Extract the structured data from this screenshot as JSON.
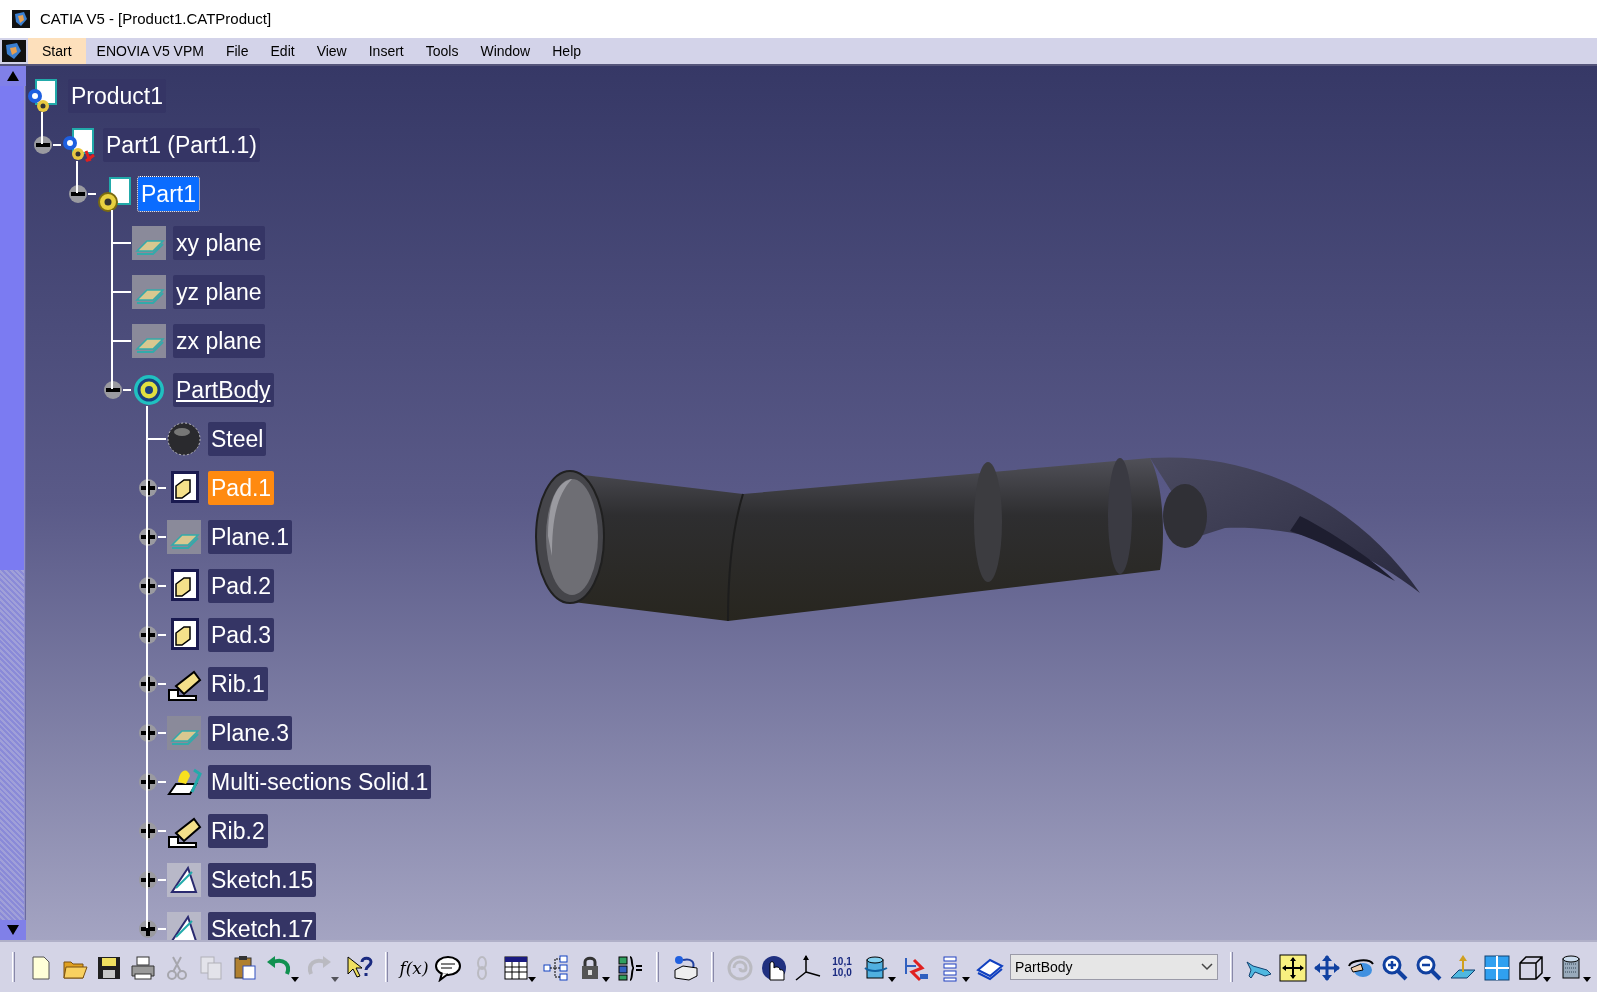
{
  "window": {
    "title": "CATIA V5 - [Product1.CATProduct]"
  },
  "menu": [
    {
      "label": "Start",
      "selected": true
    },
    {
      "label": "ENOVIA V5 VPM",
      "selected": false
    },
    {
      "label": "File",
      "selected": false
    },
    {
      "label": "Edit",
      "selected": false
    },
    {
      "label": "View",
      "selected": false
    },
    {
      "label": "Insert",
      "selected": false
    },
    {
      "label": "Tools",
      "selected": false
    },
    {
      "label": "Window",
      "selected": false
    },
    {
      "label": "Help",
      "selected": false
    }
  ],
  "tree": [
    {
      "label": "Product1",
      "kind": "product",
      "expandable": false,
      "selected": false,
      "preselected": false,
      "in_work": false,
      "children": [
        {
          "label": "Part1 (Part1.1)",
          "kind": "part-instance",
          "expandable": true,
          "expanded": true,
          "selected": false,
          "preselected": false,
          "in_work": false,
          "children": [
            {
              "label": "Part1",
              "kind": "part",
              "expandable": true,
              "expanded": true,
              "selected": true,
              "preselected": false,
              "in_work": false,
              "children": [
                {
                  "label": "xy plane",
                  "kind": "plane",
                  "expandable": false,
                  "selected": false,
                  "preselected": false,
                  "in_work": false
                },
                {
                  "label": "yz plane",
                  "kind": "plane",
                  "expandable": false,
                  "selected": false,
                  "preselected": false,
                  "in_work": false
                },
                {
                  "label": "zx plane",
                  "kind": "plane",
                  "expandable": false,
                  "selected": false,
                  "preselected": false,
                  "in_work": false
                },
                {
                  "label": "PartBody",
                  "kind": "body",
                  "expandable": true,
                  "expanded": true,
                  "selected": false,
                  "preselected": false,
                  "in_work": true,
                  "children": [
                    {
                      "label": "Steel",
                      "kind": "material",
                      "expandable": false,
                      "selected": false,
                      "preselected": false,
                      "in_work": false
                    },
                    {
                      "label": "Pad.1",
                      "kind": "pad",
                      "expandable": true,
                      "expanded": false,
                      "selected": false,
                      "preselected": true,
                      "in_work": false
                    },
                    {
                      "label": "Plane.1",
                      "kind": "plane",
                      "expandable": true,
                      "expanded": false,
                      "selected": false,
                      "preselected": false,
                      "in_work": false
                    },
                    {
                      "label": "Pad.2",
                      "kind": "pad",
                      "expandable": true,
                      "expanded": false,
                      "selected": false,
                      "preselected": false,
                      "in_work": false
                    },
                    {
                      "label": "Pad.3",
                      "kind": "pad",
                      "expandable": true,
                      "expanded": false,
                      "selected": false,
                      "preselected": false,
                      "in_work": false
                    },
                    {
                      "label": "Rib.1",
                      "kind": "rib",
                      "expandable": true,
                      "expanded": false,
                      "selected": false,
                      "preselected": false,
                      "in_work": false
                    },
                    {
                      "label": "Plane.3",
                      "kind": "plane",
                      "expandable": true,
                      "expanded": false,
                      "selected": false,
                      "preselected": false,
                      "in_work": false
                    },
                    {
                      "label": "Multi-sections Solid.1",
                      "kind": "loft",
                      "expandable": true,
                      "expanded": false,
                      "selected": false,
                      "preselected": false,
                      "in_work": false
                    },
                    {
                      "label": "Rib.2",
                      "kind": "rib",
                      "expandable": true,
                      "expanded": false,
                      "selected": false,
                      "preselected": false,
                      "in_work": false
                    },
                    {
                      "label": "Sketch.15",
                      "kind": "sketch",
                      "expandable": true,
                      "expanded": false,
                      "selected": false,
                      "preselected": false,
                      "in_work": false
                    },
                    {
                      "label": "Sketch.17",
                      "kind": "sketch",
                      "expandable": true,
                      "expanded": false,
                      "selected": false,
                      "preselected": false,
                      "in_work": false
                    }
                  ]
                }
              ]
            }
          ]
        }
      ]
    }
  ],
  "toolbar": [
    {
      "kind": "grip"
    },
    {
      "kind": "new",
      "disabled": false,
      "dropdown": false
    },
    {
      "kind": "open",
      "disabled": false,
      "dropdown": false
    },
    {
      "kind": "save",
      "disabled": false,
      "dropdown": false
    },
    {
      "kind": "print",
      "disabled": false,
      "dropdown": false
    },
    {
      "kind": "cut",
      "disabled": true,
      "dropdown": false
    },
    {
      "kind": "copy",
      "disabled": true,
      "dropdown": false
    },
    {
      "kind": "paste",
      "disabled": false,
      "dropdown": false
    },
    {
      "kind": "undo",
      "disabled": false,
      "dropdown": true
    },
    {
      "kind": "redo",
      "disabled": true,
      "dropdown": true
    },
    {
      "kind": "whats-this",
      "disabled": false,
      "dropdown": false
    },
    {
      "kind": "grip"
    },
    {
      "kind": "formula",
      "label": "f(x)",
      "disabled": false,
      "dropdown": false
    },
    {
      "kind": "comment",
      "disabled": false,
      "dropdown": false
    },
    {
      "kind": "link",
      "disabled": true,
      "dropdown": false
    },
    {
      "kind": "table",
      "disabled": false,
      "dropdown": true
    },
    {
      "kind": "graph",
      "disabled": false,
      "dropdown": false
    },
    {
      "kind": "lock",
      "disabled": false,
      "dropdown": true
    },
    {
      "kind": "parameters",
      "disabled": false,
      "dropdown": false
    },
    {
      "kind": "grip"
    },
    {
      "kind": "transfer",
      "disabled": false,
      "dropdown": false
    },
    {
      "kind": "grip"
    },
    {
      "kind": "swirl",
      "disabled": true,
      "dropdown": false
    },
    {
      "kind": "hand",
      "disabled": false,
      "dropdown": false
    },
    {
      "kind": "axis",
      "disabled": false,
      "dropdown": false
    },
    {
      "kind": "values",
      "lines": [
        "10,1",
        "10,0"
      ],
      "disabled": false,
      "dropdown": false
    },
    {
      "kind": "cube",
      "disabled": false,
      "dropdown": true
    },
    {
      "kind": "snap",
      "disabled": false,
      "dropdown": false
    },
    {
      "kind": "list",
      "disabled": false,
      "dropdown": true
    },
    {
      "kind": "layers",
      "disabled": false,
      "dropdown": false
    },
    {
      "kind": "select",
      "value": "PartBody"
    },
    {
      "kind": "grip"
    },
    {
      "kind": "fly",
      "disabled": false,
      "dropdown": false
    },
    {
      "kind": "fit-all",
      "disabled": false,
      "dropdown": false
    },
    {
      "kind": "pan",
      "disabled": false,
      "dropdown": false
    },
    {
      "kind": "rotate",
      "disabled": false,
      "dropdown": false
    },
    {
      "kind": "zoom-in",
      "disabled": false,
      "dropdown": false
    },
    {
      "kind": "zoom-out",
      "disabled": false,
      "dropdown": false
    },
    {
      "kind": "normal-view",
      "disabled": false,
      "dropdown": false
    },
    {
      "kind": "multi-view",
      "disabled": false,
      "dropdown": false
    },
    {
      "kind": "iso-view",
      "disabled": false,
      "dropdown": true
    },
    {
      "kind": "shading",
      "disabled": false,
      "dropdown": true
    }
  ]
}
